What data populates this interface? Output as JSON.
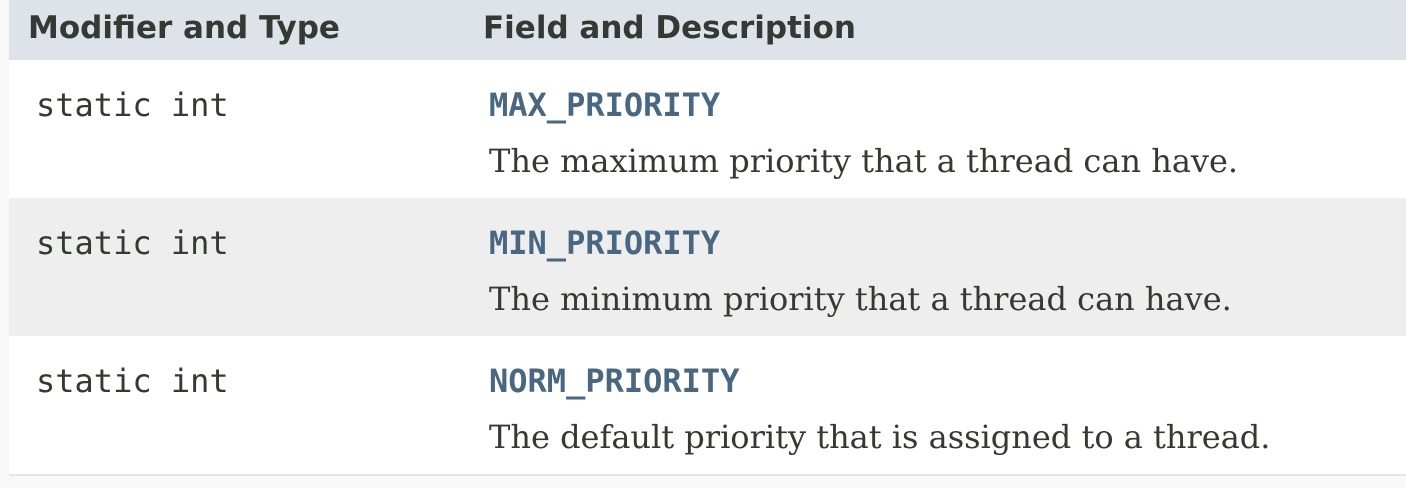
{
  "table": {
    "headers": {
      "modifier_type": "Modifier and Type",
      "field_description": "Field and Description"
    },
    "rows": [
      {
        "modifier_type": "static int",
        "field": "MAX_PRIORITY",
        "description": "The maximum priority that a thread can have."
      },
      {
        "modifier_type": "static int",
        "field": "MIN_PRIORITY",
        "description": "The minimum priority that a thread can have."
      },
      {
        "modifier_type": "static int",
        "field": "NORM_PRIORITY",
        "description": "The default priority that is assigned to a thread."
      }
    ]
  },
  "colors": {
    "header_background": "#dee3e9",
    "alt_row_background": "#eeeeee",
    "link": "#4a6782",
    "text": "#353833"
  }
}
